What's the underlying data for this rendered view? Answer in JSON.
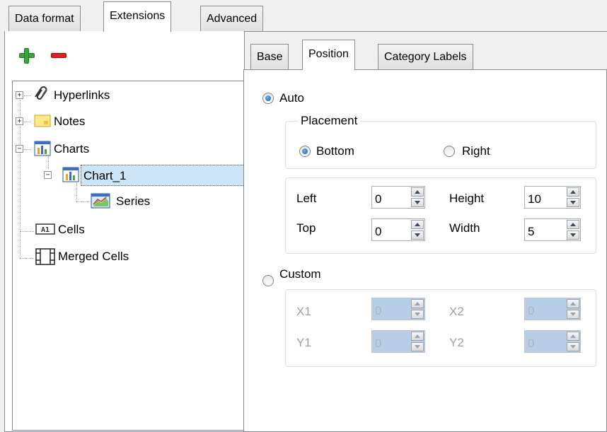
{
  "main_tabs": [
    {
      "label": "Data format",
      "active": false
    },
    {
      "label": "Extensions",
      "active": true
    },
    {
      "label": "Advanced",
      "active": false
    }
  ],
  "toolbar": {
    "add_icon": "plus-icon",
    "remove_icon": "minus-icon"
  },
  "tree": [
    {
      "label": "Hyperlinks",
      "icon": "hyperlink-icon",
      "expander": "+"
    },
    {
      "label": "Notes",
      "icon": "note-icon",
      "expander": "+"
    },
    {
      "label": "Charts",
      "icon": "chart-icon",
      "expander": "−"
    },
    {
      "label": "Chart_1",
      "icon": "chart-icon",
      "expander": "−",
      "selected": true
    },
    {
      "label": "Series",
      "icon": "series-icon"
    },
    {
      "label": "Cells",
      "icon": "cell-icon"
    },
    {
      "label": "Merged Cells",
      "icon": "merged-cells-icon"
    }
  ],
  "sub_tabs": [
    {
      "label": "Base",
      "active": false
    },
    {
      "label": "Position",
      "active": true
    },
    {
      "label": "Category Labels",
      "active": false
    }
  ],
  "position": {
    "auto_label": "Auto",
    "auto_selected": true,
    "placement": {
      "title": "Placement",
      "bottom_label": "Bottom",
      "right_label": "Right",
      "selected": "Bottom"
    },
    "left": {
      "label": "Left",
      "value": "0"
    },
    "top": {
      "label": "Top",
      "value": "0"
    },
    "height": {
      "label": "Height",
      "value": "10"
    },
    "width": {
      "label": "Width",
      "value": "5"
    },
    "custom_label": "Custom",
    "custom_selected": false,
    "x1": {
      "label": "X1",
      "value": "0"
    },
    "y1": {
      "label": "Y1",
      "value": "0"
    },
    "x2": {
      "label": "X2",
      "value": "0"
    },
    "y2": {
      "label": "Y2",
      "value": "0"
    }
  },
  "colors": {
    "selection": "#cce4f7",
    "disabled_field": "#b8cde6",
    "radio_accent": "#1a5fb4"
  }
}
